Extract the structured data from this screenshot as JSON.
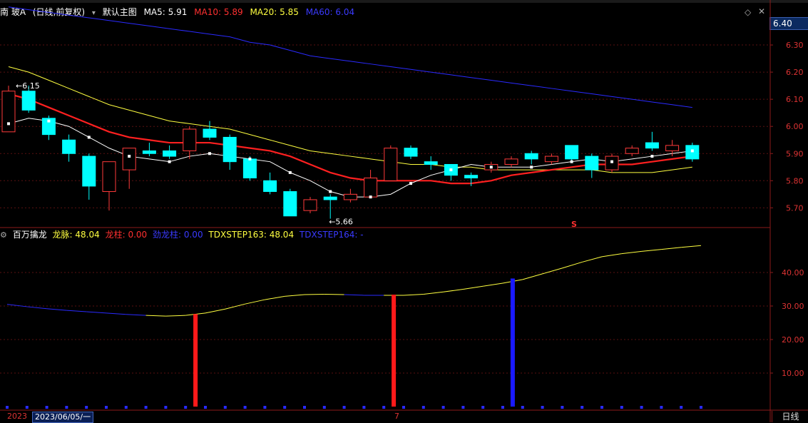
{
  "colors": {
    "up": "#ff3a3a",
    "down": "#00ffff",
    "ma5": "#ffffff",
    "ma10": "#ff2020",
    "ma20": "#ffff40",
    "ma60": "#2a2aff",
    "axis": "#8b1a1a"
  },
  "header": {
    "stock_name": "南 玻A",
    "period": "(日线,前复权)",
    "template_icon": "chevron-down-icon",
    "template": "默认主图",
    "ma5": "MA5: 5.91",
    "ma10": "MA10: 5.89",
    "ma20": "MA20: 5.85",
    "ma60": "MA60: 6.04"
  },
  "price_axis": {
    "current": "6.40",
    "ticks": [
      "6.40",
      "6.30",
      "6.20",
      "6.10",
      "6.00",
      "5.90",
      "5.80",
      "5.70"
    ]
  },
  "annotations": {
    "high": "6.15",
    "low": "5.66",
    "signal": "S"
  },
  "indicator": {
    "name": "百万擒龙",
    "longmai": "龙脉: 48.04",
    "longzhu": "龙柱: 0.00",
    "jinglongzhu": "劲龙柱: 0.00",
    "step163": "TDXSTEP163: 48.04",
    "step164": "TDXSTEP164: -",
    "ticks": [
      "40.00",
      "30.00",
      "20.00",
      "10.00"
    ]
  },
  "footer": {
    "date_left": "2023",
    "date_cursor": "2023/06/05/一",
    "date_mid": "7",
    "period_button": "日线"
  },
  "chart_data": [
    {
      "type": "candlestick",
      "title": "南 玻A (日线,前复权)",
      "ylim": [
        5.63,
        6.4
      ],
      "candles": [
        {
          "o": 5.98,
          "c": 6.13,
          "h": 6.15,
          "l": 5.98
        },
        {
          "o": 6.13,
          "c": 6.06,
          "h": 6.15,
          "l": 6.05
        },
        {
          "o": 6.03,
          "c": 5.97,
          "h": 6.04,
          "l": 5.95
        },
        {
          "o": 5.95,
          "c": 5.9,
          "h": 5.97,
          "l": 5.87
        },
        {
          "o": 5.89,
          "c": 5.78,
          "h": 5.9,
          "l": 5.73
        },
        {
          "o": 5.76,
          "c": 5.87,
          "h": 5.87,
          "l": 5.69
        },
        {
          "o": 5.84,
          "c": 5.92,
          "h": 5.92,
          "l": 5.77
        },
        {
          "o": 5.91,
          "c": 5.9,
          "h": 5.94,
          "l": 5.89
        },
        {
          "o": 5.91,
          "c": 5.89,
          "h": 5.93,
          "l": 5.88
        },
        {
          "o": 5.91,
          "c": 5.99,
          "h": 6.0,
          "l": 5.88
        },
        {
          "o": 5.99,
          "c": 5.96,
          "h": 6.02,
          "l": 5.95
        },
        {
          "o": 5.96,
          "c": 5.87,
          "h": 5.97,
          "l": 5.84
        },
        {
          "o": 5.88,
          "c": 5.81,
          "h": 5.89,
          "l": 5.8
        },
        {
          "o": 5.8,
          "c": 5.76,
          "h": 5.83,
          "l": 5.75
        },
        {
          "o": 5.76,
          "c": 5.67,
          "h": 5.77,
          "l": 5.67
        },
        {
          "o": 5.69,
          "c": 5.73,
          "h": 5.74,
          "l": 5.68
        },
        {
          "o": 5.74,
          "c": 5.73,
          "h": 5.75,
          "l": 5.66
        },
        {
          "o": 5.73,
          "c": 5.75,
          "h": 5.77,
          "l": 5.72
        },
        {
          "o": 5.74,
          "c": 5.81,
          "h": 5.84,
          "l": 5.74
        },
        {
          "o": 5.8,
          "c": 5.92,
          "h": 5.93,
          "l": 5.8
        },
        {
          "o": 5.92,
          "c": 5.89,
          "h": 5.93,
          "l": 5.88
        },
        {
          "o": 5.87,
          "c": 5.86,
          "h": 5.89,
          "l": 5.84
        },
        {
          "o": 5.86,
          "c": 5.82,
          "h": 5.86,
          "l": 5.8
        },
        {
          "o": 5.82,
          "c": 5.81,
          "h": 5.83,
          "l": 5.78
        },
        {
          "o": 5.84,
          "c": 5.86,
          "h": 5.87,
          "l": 5.83
        },
        {
          "o": 5.86,
          "c": 5.88,
          "h": 5.89,
          "l": 5.85
        },
        {
          "o": 5.9,
          "c": 5.88,
          "h": 5.91,
          "l": 5.86
        },
        {
          "o": 5.87,
          "c": 5.89,
          "h": 5.9,
          "l": 5.86
        },
        {
          "o": 5.93,
          "c": 5.88,
          "h": 5.93,
          "l": 5.87
        },
        {
          "o": 5.89,
          "c": 5.84,
          "h": 5.9,
          "l": 5.81
        },
        {
          "o": 5.84,
          "c": 5.89,
          "h": 5.9,
          "l": 5.83
        },
        {
          "o": 5.9,
          "c": 5.92,
          "h": 5.93,
          "l": 5.89
        },
        {
          "o": 5.94,
          "c": 5.92,
          "h": 5.98,
          "l": 5.91
        },
        {
          "o": 5.91,
          "c": 5.93,
          "h": 5.95,
          "l": 5.89
        },
        {
          "o": 5.93,
          "c": 5.88,
          "h": 5.94,
          "l": 5.87
        }
      ],
      "ma5": [
        6.01,
        6.03,
        6.02,
        6.0,
        5.96,
        5.92,
        5.89,
        5.88,
        5.87,
        5.89,
        5.9,
        5.89,
        5.88,
        5.87,
        5.83,
        5.8,
        5.76,
        5.74,
        5.74,
        5.75,
        5.79,
        5.82,
        5.84,
        5.86,
        5.85,
        5.85,
        5.85,
        5.86,
        5.87,
        5.88,
        5.87,
        5.88,
        5.89,
        5.9,
        5.91
      ],
      "ma10": [
        6.12,
        6.1,
        6.07,
        6.04,
        6.01,
        5.98,
        5.96,
        5.95,
        5.94,
        5.94,
        5.94,
        5.93,
        5.92,
        5.91,
        5.89,
        5.86,
        5.83,
        5.81,
        5.8,
        5.8,
        5.8,
        5.8,
        5.79,
        5.79,
        5.8,
        5.82,
        5.83,
        5.84,
        5.85,
        5.86,
        5.86,
        5.86,
        5.87,
        5.88,
        5.89
      ],
      "ma20": [
        6.22,
        6.2,
        6.17,
        6.14,
        6.11,
        6.08,
        6.06,
        6.04,
        6.02,
        6.01,
        6.0,
        5.99,
        5.97,
        5.95,
        5.93,
        5.91,
        5.9,
        5.89,
        5.88,
        5.87,
        5.86,
        5.86,
        5.85,
        5.85,
        5.84,
        5.84,
        5.84,
        5.84,
        5.84,
        5.84,
        5.83,
        5.83,
        5.83,
        5.84,
        5.85
      ],
      "ma60": [
        6.44,
        6.43,
        6.42,
        6.41,
        6.4,
        6.39,
        6.38,
        6.37,
        6.36,
        6.35,
        6.34,
        6.33,
        6.31,
        6.3,
        6.28,
        6.26,
        6.25,
        6.24,
        6.23,
        6.22,
        6.21,
        6.2,
        6.19,
        6.18,
        6.17,
        6.16,
        6.15,
        6.14,
        6.13,
        6.12,
        6.11,
        6.1,
        6.09,
        6.08,
        6.07
      ]
    },
    {
      "type": "line",
      "ylim": [
        0,
        50
      ],
      "longmai": [
        30.5,
        29.8,
        29.2,
        28.7,
        28.3,
        27.9,
        27.5,
        27.2,
        27.0,
        27.2,
        27.9,
        29.1,
        30.6,
        31.9,
        32.9,
        33.4,
        33.5,
        33.4,
        33.2,
        33.2,
        33.2,
        33.5,
        34.2,
        35.0,
        35.9,
        36.8,
        37.9,
        39.6,
        41.3,
        43.1,
        44.7,
        45.6,
        46.3,
        46.9,
        47.5,
        48.04
      ],
      "bars": [
        {
          "i": 9.5,
          "value": 27.6,
          "color": "red"
        },
        {
          "i": 19.5,
          "value": 33.4,
          "color": "red"
        },
        {
          "i": 25.5,
          "value": 38.2,
          "color": "blue"
        }
      ]
    }
  ]
}
